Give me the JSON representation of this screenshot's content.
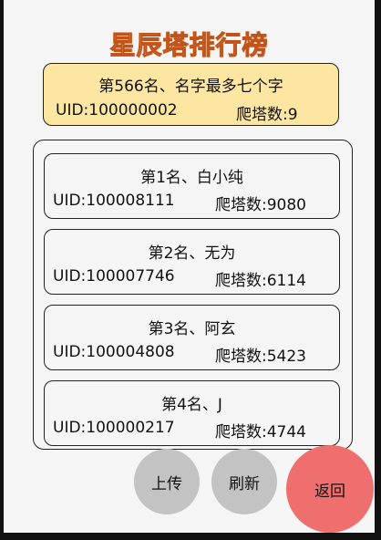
{
  "title": "星辰塔排行榜",
  "my_rank": {
    "line": "第566名、名字最多七个字",
    "uid": "UID:100000002",
    "score": "爬塔数:9"
  },
  "rankings": [
    {
      "name": "第1名、白小纯",
      "uid": "UID:100008111",
      "score": "爬塔数:9080"
    },
    {
      "name": "第2名、无为",
      "uid": "UID:100007746",
      "score": "爬塔数:6114"
    },
    {
      "name": "第3名、阿玄",
      "uid": "UID:100004808",
      "score": "爬塔数:5423"
    },
    {
      "name": "第4名、J",
      "uid": "UID:100000217",
      "score": "爬塔数:4744"
    }
  ],
  "buttons": {
    "upload": "上传",
    "refresh": "刷新",
    "back": "返回"
  }
}
